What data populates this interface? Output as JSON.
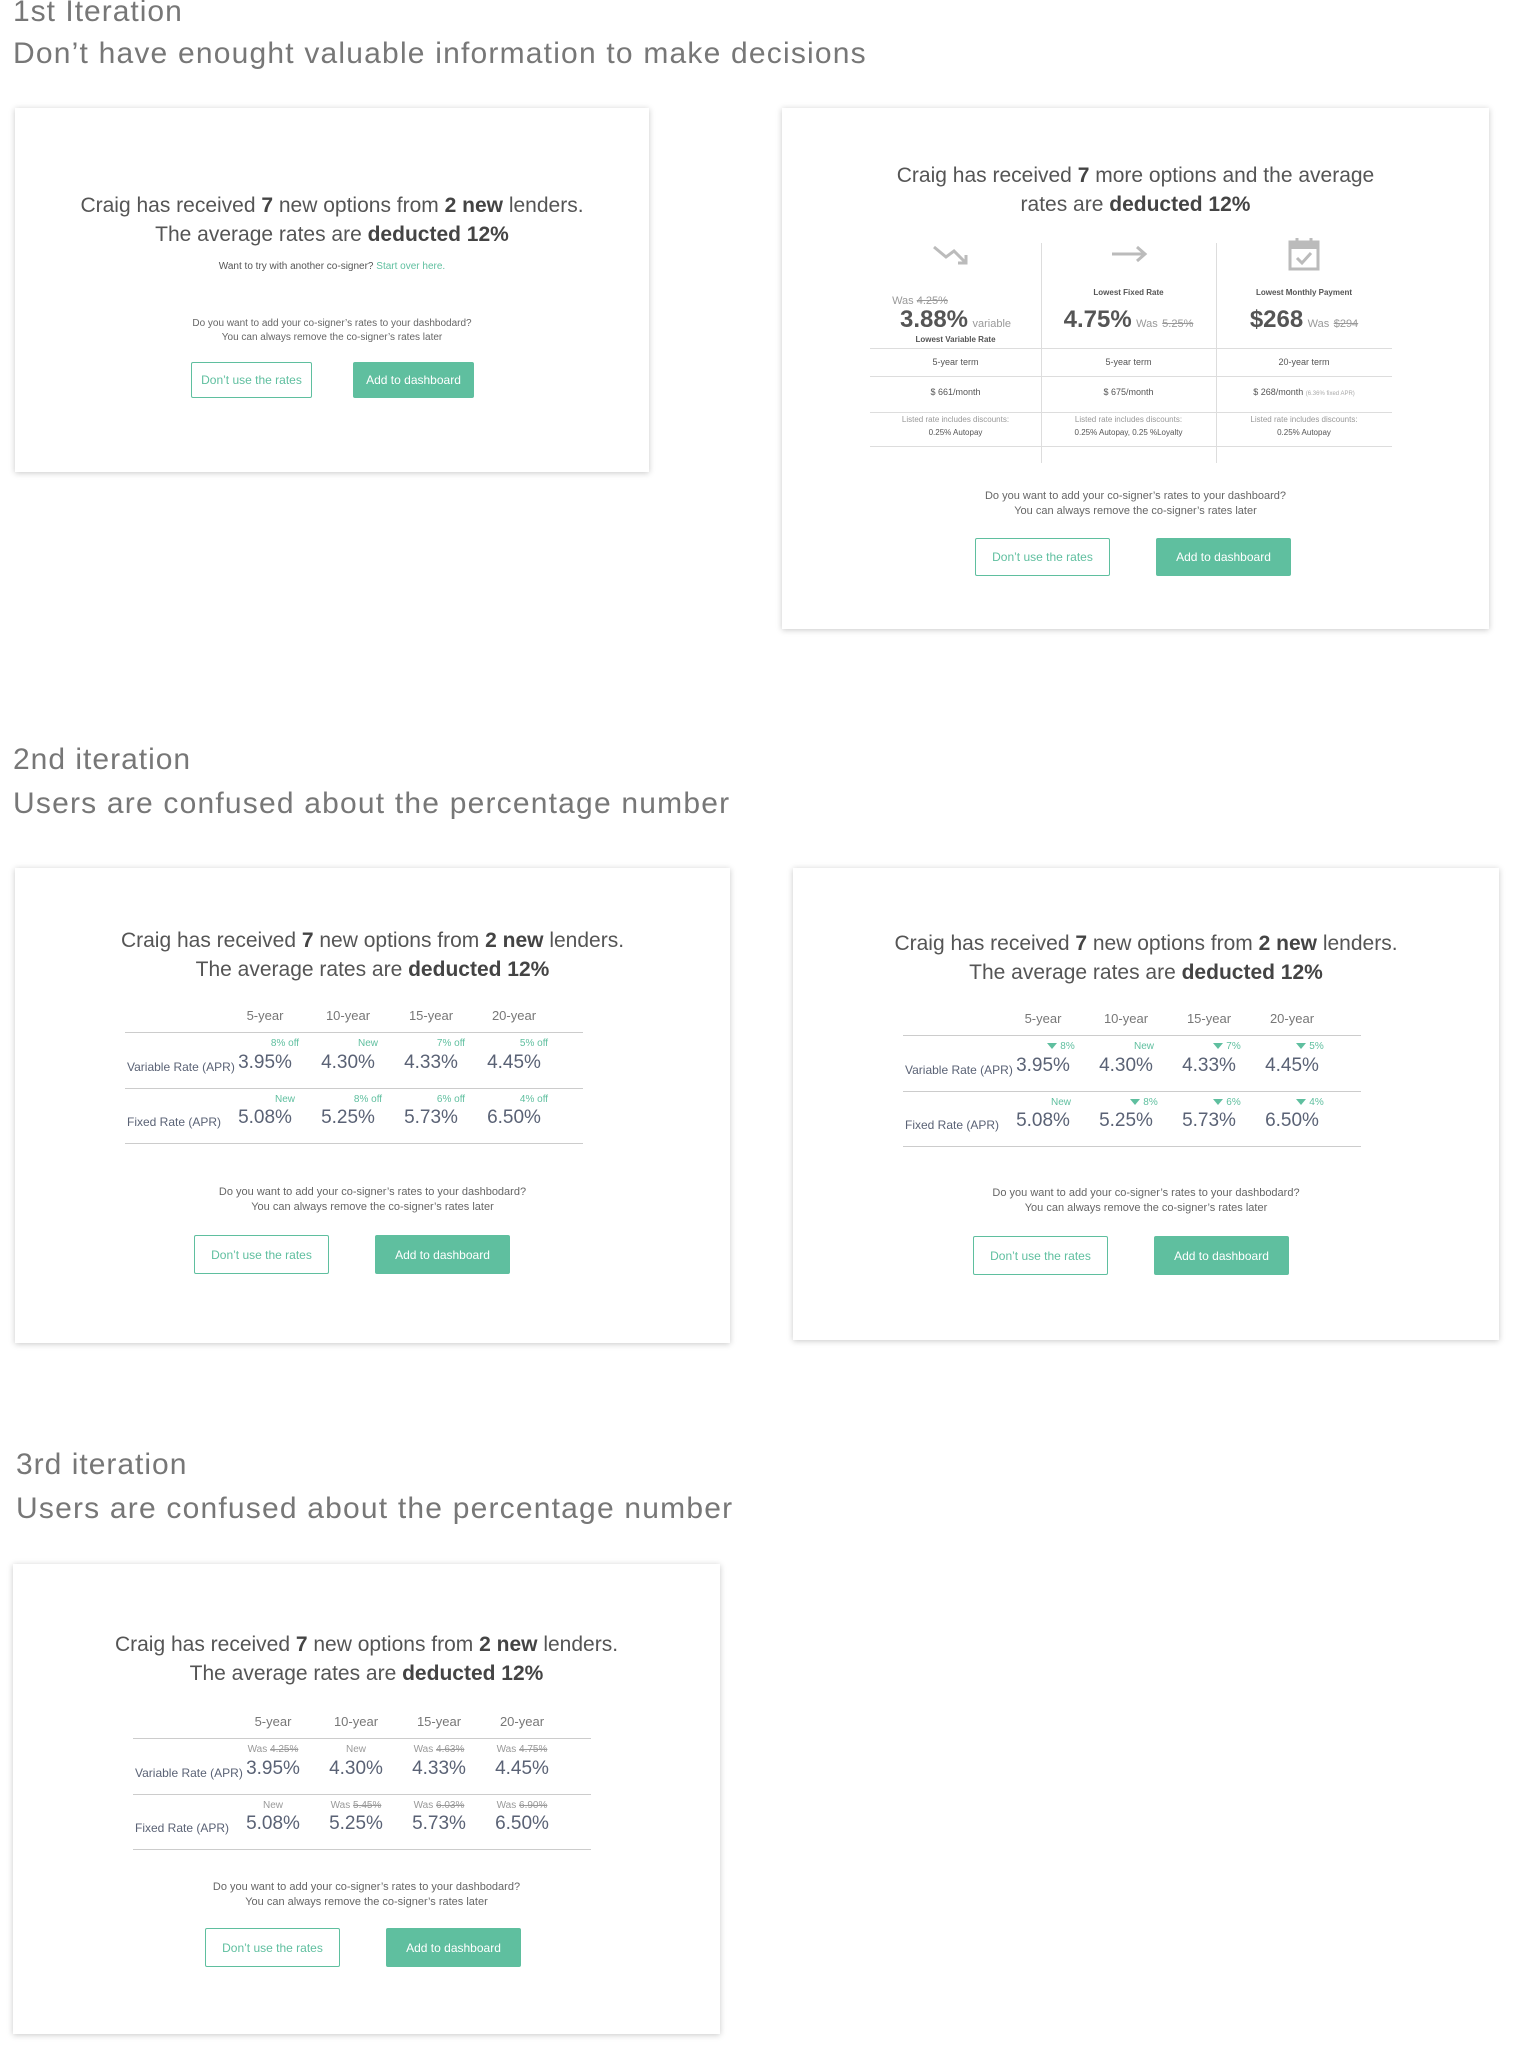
{
  "sections": [
    {
      "title": "1st Iteration",
      "subtitle": "Don’t have enought valuable information to make decisions"
    },
    {
      "title": "2nd iteration",
      "subtitle": "Users are confused about the percentage number"
    },
    {
      "title": "3rd iteration",
      "subtitle": "Users are confused about the percentage number"
    }
  ],
  "common": {
    "name": "Craig",
    "question_line1": "Do you want to add your co-signer’s rates to your dashbodard?",
    "question_line2": "You can always remove the co-signer’s rates later",
    "dont_use": "Don’t use the rates",
    "add_dashboard": "Add to dashboard",
    "headline_a1": "Craig has received ",
    "headline_a2": "7",
    "headline_a3": " new options from ",
    "headline_a4": "2 new",
    "headline_a5": " lenders.",
    "headline_b1": "The average rates are ",
    "headline_b2": "deducted 12%"
  },
  "iter1_left": {
    "cosigner_prompt": "Want to try with another co-signer?",
    "start_over": "Start over here.",
    "question_line1": "Do you want to add your co-signer’s rates to your dashbodard?"
  },
  "iter1_right": {
    "headline_1": "Craig has received ",
    "headline_2": "7",
    "headline_3": " more options and the average",
    "headline_4": "rates are ",
    "headline_5": "deducted 12%",
    "col1": {
      "was_prefix": "Was",
      "was": "4.25%",
      "big": "3.88%",
      "suffix": "variable",
      "label": "Lowest Variable Rate",
      "term": "5-year term",
      "monthly": "$ 661/month",
      "note": "Listed rate includes discounts:",
      "discount": "0.25% Autopay"
    },
    "col2": {
      "label": "Lowest Fixed Rate",
      "big": "4.75%",
      "was_prefix": "Was",
      "was": "5.25%",
      "term": "5-year term",
      "monthly": "$ 675/month",
      "note": "Listed rate includes discounts:",
      "discount": "0.25% Autopay, 0.25 %Loyalty"
    },
    "col3": {
      "label": "Lowest Monthly Payment",
      "big": "$268",
      "was_prefix": "Was",
      "was": "$294",
      "term": "20-year term",
      "monthly": "$ 268/month",
      "monthly_note": "(6.36% fixed APR)",
      "note": "Listed rate includes discounts:",
      "discount": "0.25% Autopay"
    },
    "icons": [
      "trend-down-icon",
      "arrow-right-icon",
      "calendar-check-icon"
    ],
    "question_line1": "Do you want to add your co-signer’s rates to your dashboard?"
  },
  "table": {
    "terms": [
      "5-year",
      "10-year",
      "15-year",
      "20-year"
    ],
    "variable_label": "Variable Rate (APR)",
    "fixed_label": "Fixed Rate (APR)",
    "variable_values": [
      "3.95%",
      "4.30%",
      "4.33%",
      "4.45%"
    ],
    "fixed_values": [
      "5.08%",
      "5.25%",
      "5.73%",
      "6.50%"
    ]
  },
  "iter2_left": {
    "variable_tags": [
      "8% off",
      "New",
      "7% off",
      "5% off"
    ],
    "fixed_tags": [
      "New",
      "8% off",
      "6% off",
      "4% off"
    ]
  },
  "iter2_right": {
    "variable_tags": [
      "8%",
      "New",
      "7%",
      "5%"
    ],
    "variable_arrows": [
      true,
      false,
      true,
      true
    ],
    "fixed_tags": [
      "New",
      "8%",
      "6%",
      "4%"
    ],
    "fixed_arrows": [
      false,
      true,
      true,
      true
    ]
  },
  "iter3": {
    "was_prefix": "Was",
    "variable_was": [
      "4.25%",
      "",
      "4.63%",
      "4.75%"
    ],
    "variable_new": [
      "",
      "New",
      "",
      ""
    ],
    "fixed_was": [
      "",
      "5.45%",
      "6.03%",
      "6.90%"
    ],
    "fixed_new": [
      "New",
      "",
      "",
      ""
    ]
  },
  "colors": {
    "accent": "#5fbf9f",
    "text": "#555555",
    "value": "#5a6275"
  }
}
